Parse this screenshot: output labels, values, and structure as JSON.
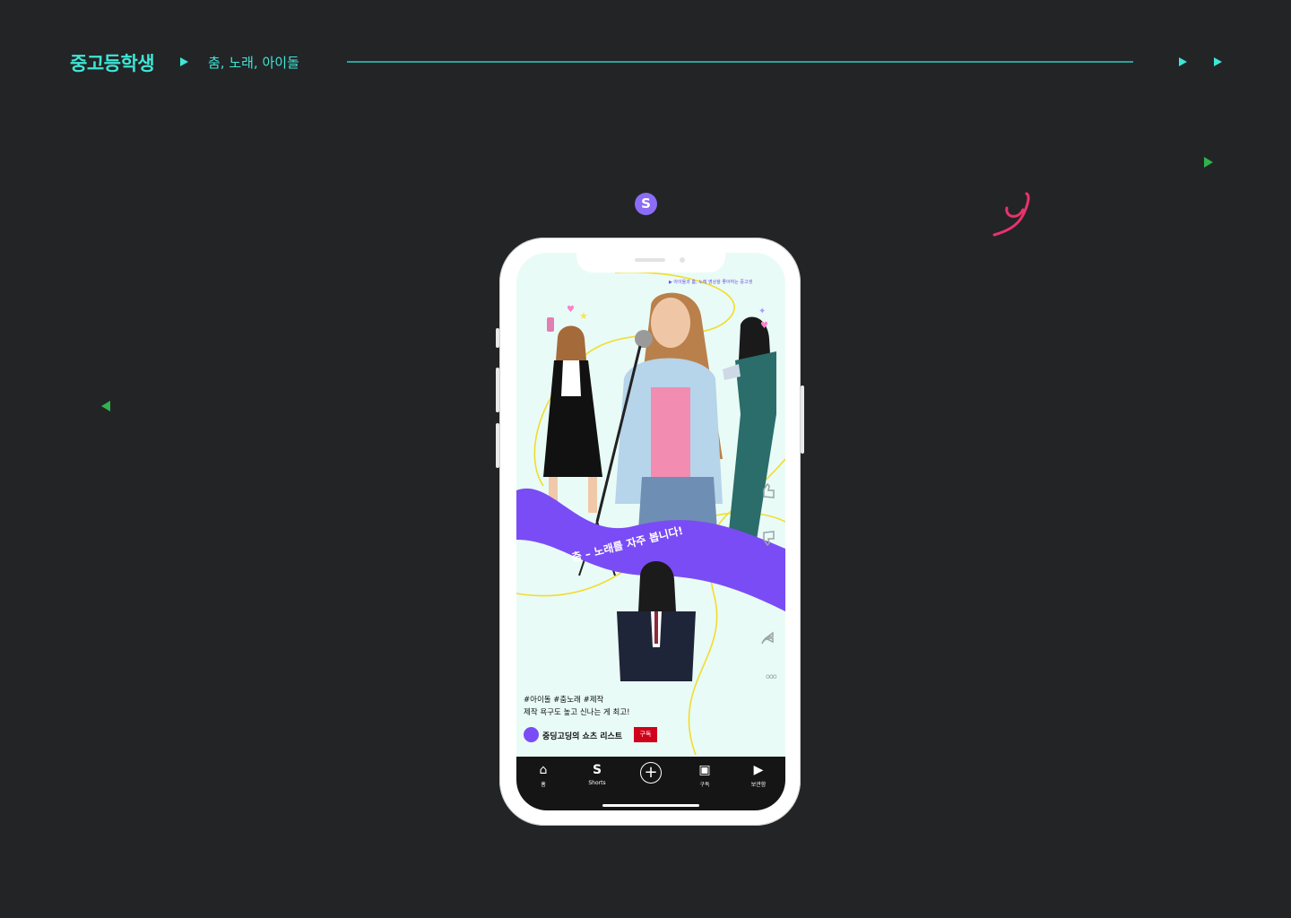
{
  "header": {
    "title": "중고등학생",
    "subtitle": "춤, 노래, 아이돌"
  },
  "badge": {
    "letter": "S"
  },
  "shorts_screen": {
    "top_text": "▶ 아이돌과 춤, 노래 영상을 좋아하는 중고생",
    "banner_text": "춤 – 노래를 자주 봅니다!",
    "hashtags": "#아이돌 #춤노래 #제작",
    "description": "제작 욕구도 높고 신나는 게 최고!",
    "channel_name": "중딩고딩의 쇼츠 리스트",
    "subscribe_label": "구독"
  },
  "bottom_nav": [
    {
      "label": "홈",
      "icon": "home-icon"
    },
    {
      "label": "Shorts",
      "icon": "shorts-icon"
    },
    {
      "label": "",
      "icon": "create-plus-icon"
    },
    {
      "label": "구독",
      "icon": "subscriptions-icon"
    },
    {
      "label": "보관함",
      "icon": "library-icon"
    }
  ],
  "colors": {
    "accent_teal": "#3ee6d6",
    "purple": "#7a4cf5",
    "yellow_line": "#f2dc2b",
    "pink": "#e8336c",
    "background": "#232426"
  }
}
